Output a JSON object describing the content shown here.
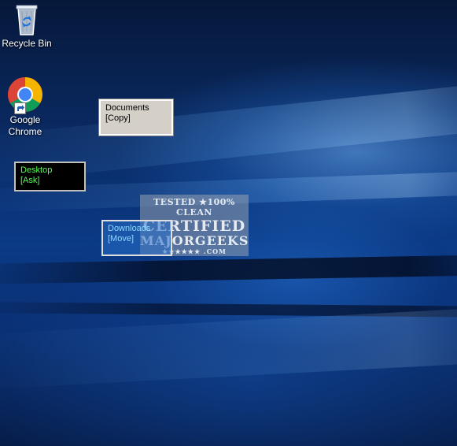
{
  "desktop": {
    "icons": [
      {
        "label": "Recycle Bin",
        "icon": "recycle-bin-icon"
      },
      {
        "label_line1": "Google",
        "label_line2": "Chrome",
        "icon": "chrome-icon"
      }
    ]
  },
  "folder_windows": {
    "documents": {
      "name": "Documents",
      "action": "[Copy]"
    },
    "desktop": {
      "name": "Desktop",
      "action": "[Ask]"
    },
    "downloads": {
      "name": "Downloads",
      "action": "[Move]"
    }
  },
  "watermark": {
    "line1": "TESTED ★100% CLEAN",
    "line2": "CERTIFIED",
    "line3": "MAJORGEEKS",
    "line4": "★★★★★★ .COM"
  },
  "colors": {
    "documents_bg": "#d4d0c8",
    "desktop_bg": "#000000",
    "desktop_text": "#55ff55",
    "downloads_text": "#8fd8ff"
  }
}
